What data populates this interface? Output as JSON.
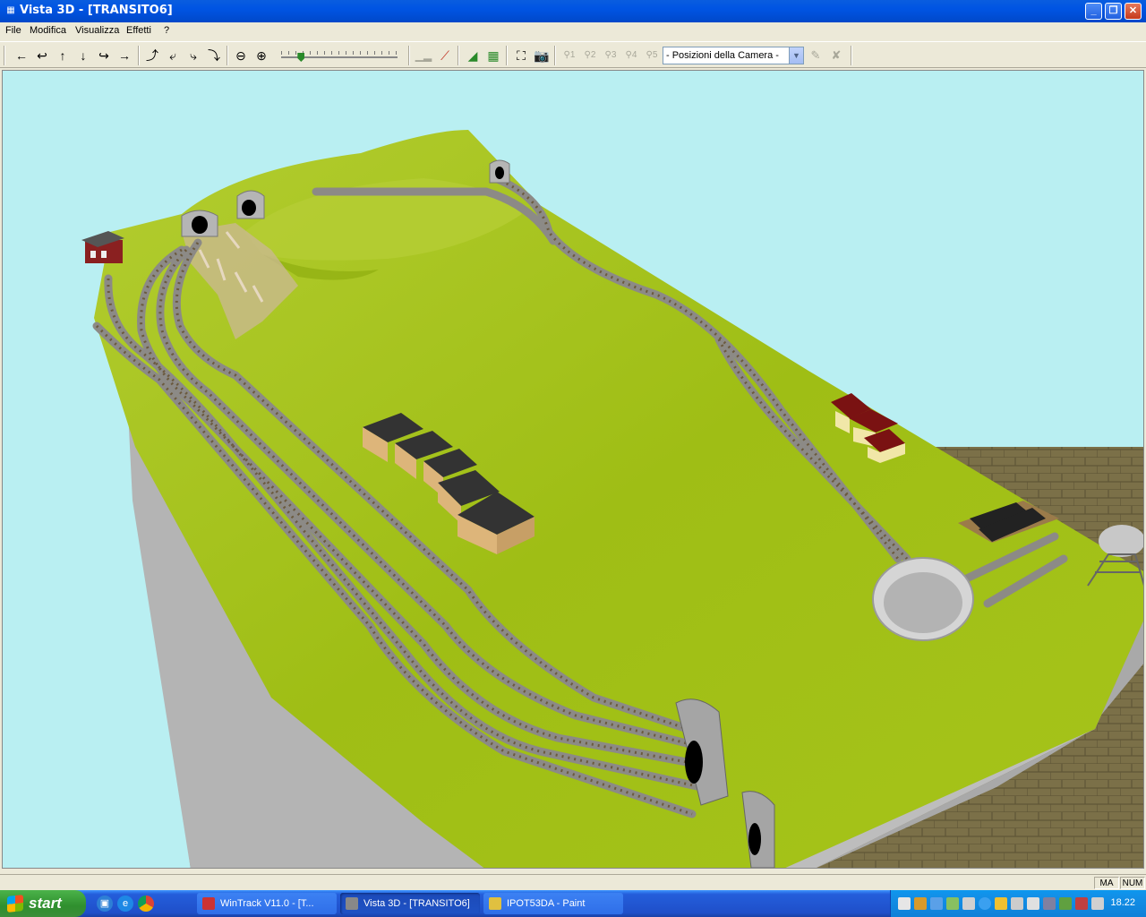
{
  "window": {
    "title": "Vista 3D - [TRANSITO6]",
    "controls": {
      "minimize": "_",
      "restore": "❐",
      "close": "✕"
    }
  },
  "menu": {
    "items": [
      "File",
      "Modifica",
      "Visualizza",
      "Effetti",
      "?"
    ]
  },
  "toolbar": {
    "nav_icons": [
      "arrow-left-icon",
      "arrow-turn-left-icon",
      "arrow-up-icon",
      "arrow-down-icon",
      "arrow-turn-right-icon",
      "arrow-right-icon"
    ],
    "view_icons": [
      "rotate-up-icon",
      "rotate-left-icon",
      "rotate-right-icon",
      "rotate-down-icon"
    ],
    "zoom_icons": [
      "zoom-out-icon",
      "zoom-in-icon"
    ],
    "zoom_level": 0.15,
    "camera_presets": [
      "1",
      "2",
      "3",
      "4",
      "5"
    ],
    "camera_select": {
      "value": "- Posizioni della Camera -"
    }
  },
  "statusbar": {
    "caps": "MA",
    "num": "NUM"
  },
  "taskbar": {
    "start_label": "start",
    "tasks": [
      {
        "label": "WinTrack  V11.0 - [T...",
        "active": false
      },
      {
        "label": "Vista 3D - [TRANSITO6]",
        "active": true
      },
      {
        "label": "IPOT53DA - Paint",
        "active": false
      }
    ],
    "clock": "18.22"
  },
  "colors": {
    "sky": "#b9eff2",
    "terrain": "#a6c41a",
    "track": "#8c8a86",
    "floor": "#7b7048"
  }
}
